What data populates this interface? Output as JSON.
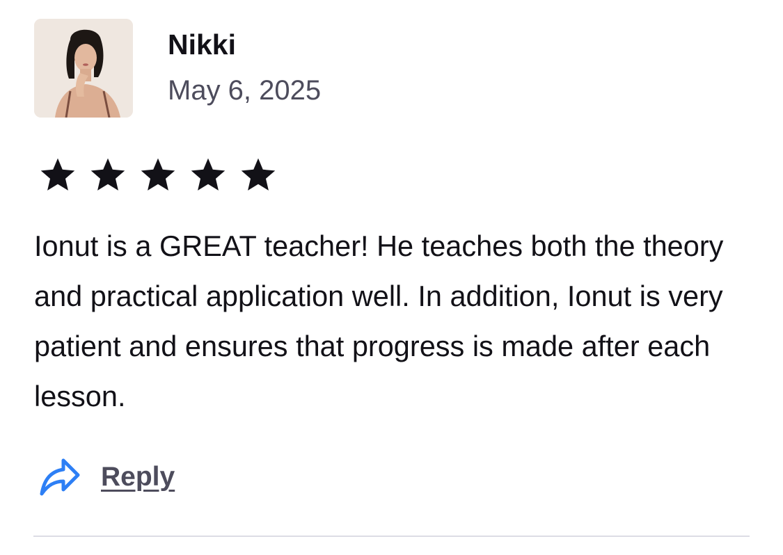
{
  "review": {
    "reviewer_name": "Nikki",
    "date": "May 6, 2025",
    "rating": 5,
    "rating_max": 5,
    "text": "Ionut is a GREAT teacher! He teaches both the theory and practical application well. In addition, Ionut is very patient and ensures that progress is made after each lesson.",
    "reply_label": "Reply"
  },
  "icons": {
    "avatar": "reviewer-photo",
    "star": "star-icon",
    "reply": "reply-arrow-icon"
  },
  "colors": {
    "text_primary": "#121117",
    "text_secondary": "#4d4c5c",
    "star": "#121117",
    "reply_icon": "#2d7ff5",
    "divider": "#dcdce5"
  }
}
